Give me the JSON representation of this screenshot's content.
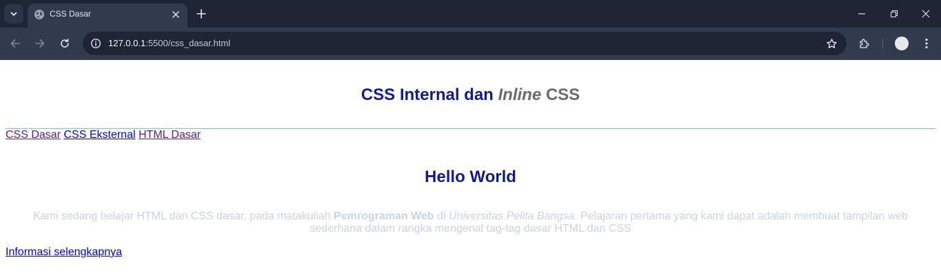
{
  "browser": {
    "tab_title": "CSS Dasar",
    "url_host": "127.0.0.1",
    "url_rest": ":5500/css_dasar.html",
    "icons": {
      "tab_search": "chevron-down-icon",
      "favicon": "globe-icon",
      "tab_close": "close-icon",
      "new_tab": "plus-icon",
      "minimize": "minimize-icon",
      "restore": "restore-icon",
      "close_window": "close-icon",
      "back": "arrow-left-icon",
      "forward": "arrow-right-icon",
      "reload": "reload-icon",
      "site_info": "info-icon",
      "bookmark": "star-icon",
      "extensions": "puzzle-icon",
      "profile": "avatar",
      "menu": "kebab-icon"
    }
  },
  "page": {
    "heading": {
      "part1": "CSS Internal dan ",
      "italic": "Inline",
      "part2": " CSS"
    },
    "nav_links": [
      "CSS Dasar",
      "CSS Eksternal",
      "HTML Dasar"
    ],
    "subheading": "Hello World",
    "paragraph": {
      "t1": "Kami sedang belajar HTML dan CSS dasar, pada matakuliah ",
      "bold": "Pemrograman Web",
      "t2": " di ",
      "italic": "Universitas Pelita Bangsa",
      "t3": ". Pelajaran pertama yang kami dapat adalah membuat tampilan web sederhana dalam rangka mengenal tag-tag dasar HTML dan CSS"
    },
    "more_link": "Informasi selengkapnya"
  },
  "colors": {
    "heading": "#131c8e",
    "heading_muted": "#6b6b6b",
    "paragraph": "#c8d6e2",
    "hr": "#7ecaca",
    "link": "#0000ee",
    "link_visited": "#551a8b"
  }
}
